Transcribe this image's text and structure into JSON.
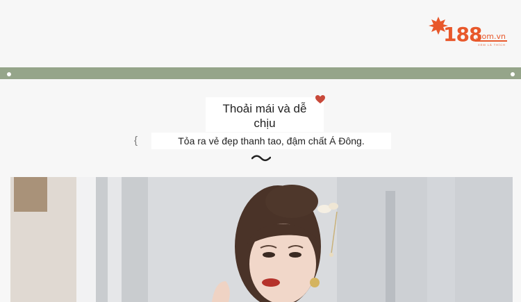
{
  "logo": {
    "number": "188",
    "domain": ".com.vn",
    "tagline": "XEM LÀ THÍCH"
  },
  "colors": {
    "brand": "#e8582b",
    "band": "#95a58a",
    "background": "#f7f7f7"
  },
  "header": {
    "title_line1": "Thoải mái và dễ",
    "title_line2": "chịu",
    "subtitle": "Tỏa ra vẻ đẹp thanh tao, đậm chất Á Đông."
  },
  "decor": {
    "brace": "{"
  }
}
